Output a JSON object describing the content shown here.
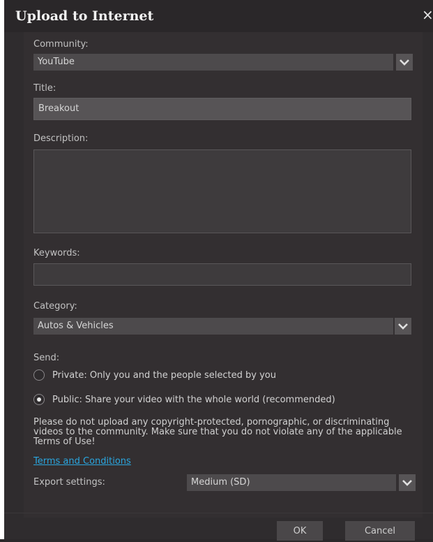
{
  "window": {
    "title": "Upload to Internet",
    "close_glyph": "×"
  },
  "form": {
    "community_label": "Community:",
    "community_value": "YouTube",
    "title_label": "Title:",
    "title_value": "Breakout",
    "description_label": "Description:",
    "description_value": "",
    "keywords_label": "Keywords:",
    "keywords_value": "",
    "category_label": "Category:",
    "category_value": "Autos & Vehicles",
    "send_label": "Send:",
    "send_options": [
      {
        "label": "Private: Only you and the people selected by you",
        "checked": false
      },
      {
        "label": "Public: Share your video with the whole world (recommended)",
        "checked": true
      }
    ],
    "warning_lines": [
      "Please do not upload any copyright-protected, pornographic, or discriminating",
      "videos to the community. Make sure that you do not violate any of the applicable",
      "Terms of Use!"
    ],
    "terms_link": "Terms and Conditions",
    "export_label": "Export settings:",
    "export_value": "Medium (SD)"
  },
  "buttons": {
    "ok": "OK",
    "cancel": "Cancel"
  },
  "icons": {
    "dropdown": "chevron-down-icon",
    "close": "close-icon"
  },
  "colors": {
    "link": "#2aa6df",
    "background": "#2f2c2e"
  }
}
